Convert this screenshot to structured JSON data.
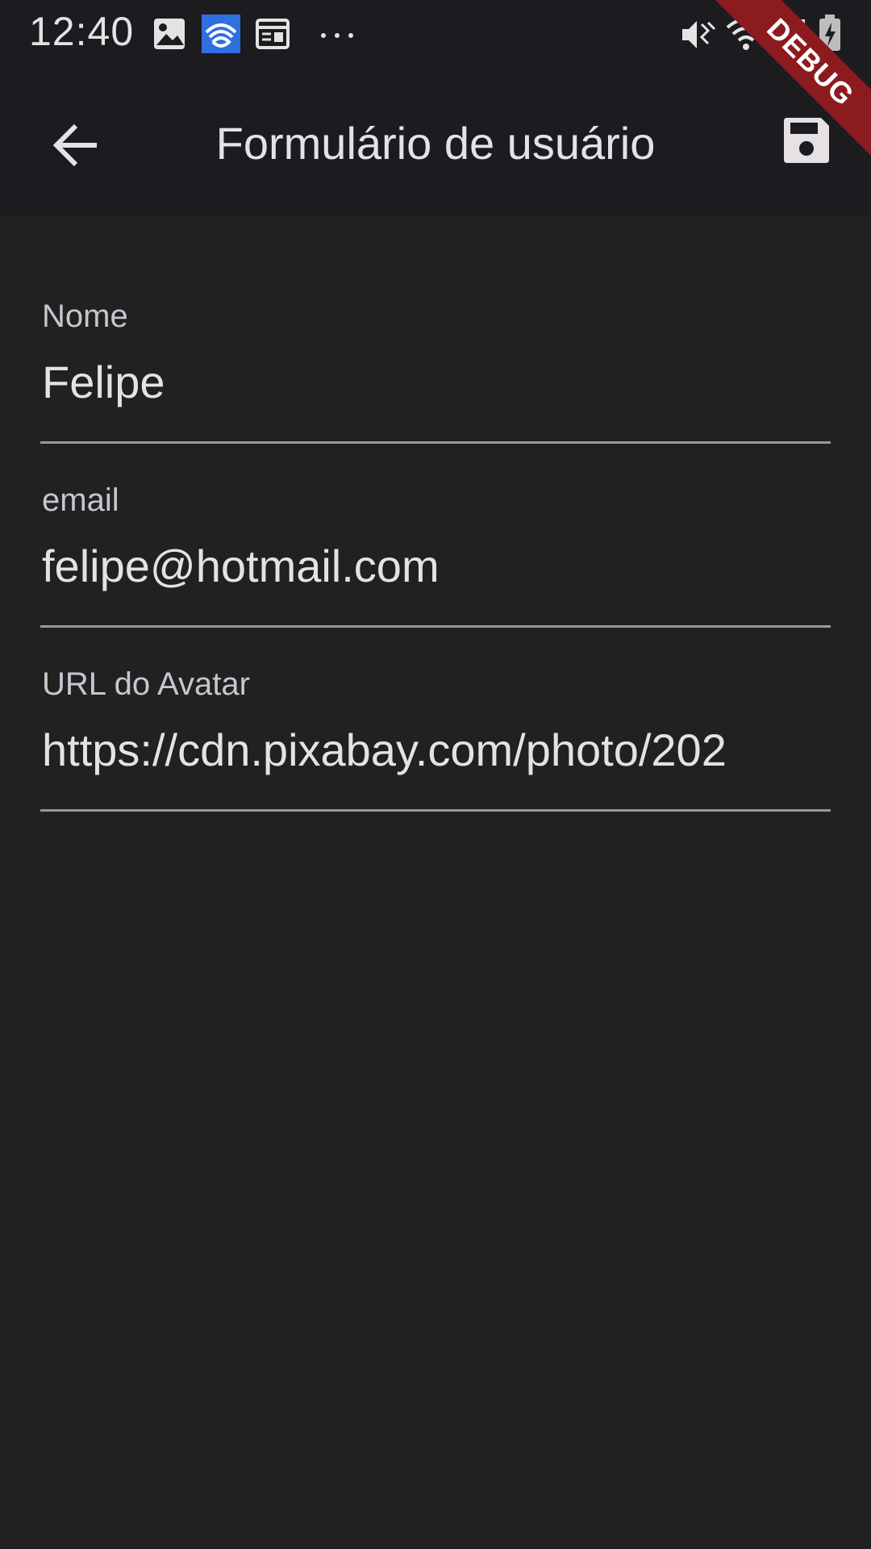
{
  "status_bar": {
    "time": "12:40",
    "icons": [
      "image-icon",
      "app-notification-icon",
      "news-icon",
      "more-dots-icon",
      "vibrate-icon",
      "wifi-icon",
      "signal-icon",
      "battery-charging-icon"
    ]
  },
  "debug_banner": "DEBUG",
  "app_bar": {
    "title": "Formulário de usuário",
    "back_icon": "arrow-back-icon",
    "save_icon": "save-icon"
  },
  "form": {
    "fields": [
      {
        "label": "Nome",
        "value": "Felipe"
      },
      {
        "label": "email",
        "value": "felipe@hotmail.com"
      },
      {
        "label": "URL do Avatar",
        "value": "https://cdn.pixabay.com/photo/202"
      }
    ]
  },
  "colors": {
    "background": "#212121",
    "app_bar": "#1c1b20",
    "text_primary": "#e6e1e5",
    "text_label": "#cac4d0",
    "underline": "#9a959e",
    "debug_banner": "#8b1b1f",
    "status_app_icon": "#2f6fe0"
  }
}
